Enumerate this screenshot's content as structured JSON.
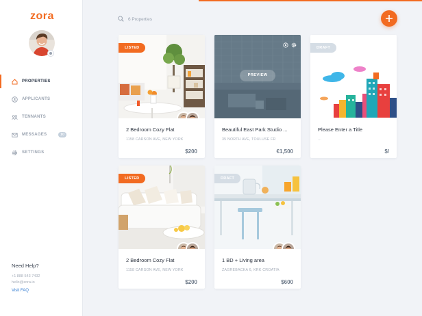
{
  "brand": {
    "name": "zora",
    "accent": "#f26b21"
  },
  "sidebar": {
    "items": [
      {
        "label": "PROPERTIES",
        "icon": "home-icon",
        "active": true
      },
      {
        "label": "APPLICANTS",
        "icon": "user-circle-icon",
        "active": false
      },
      {
        "label": "TENNANTS",
        "icon": "users-icon",
        "active": false
      },
      {
        "label": "MESSAGES",
        "icon": "envelope-icon",
        "active": false,
        "count": "10"
      },
      {
        "label": "SETTINGS",
        "icon": "gear-icon",
        "active": false
      }
    ],
    "help": {
      "title": "Need Help?",
      "phone": "+1 888 543 7432",
      "email": "hello@zora.io",
      "link": "Visit FAQ"
    }
  },
  "search": {
    "placeholder": "6 Properties"
  },
  "cards": [
    {
      "badge": "LISTED",
      "title": "2 Bedroom Cozy Flat",
      "address": "1158 CARSON AVE, NEW YORK",
      "price": "$200"
    },
    {
      "action": "PREVIEW",
      "title": "Beautiful East Park Studio ...",
      "address": "35 NORTH AVE, TOULUSE FR",
      "price": "€1,500"
    },
    {
      "badge": "DRAFT",
      "title": "Please Enter a Title",
      "address": "...",
      "price": "$/"
    },
    {
      "badge": "LISTED",
      "title": "2 Bedroom Cozy Flat",
      "address": "1158 CARSON AVE, NEW YORK",
      "price": "$200"
    },
    {
      "badge": "DRAFT",
      "title": "1 BD + Living area",
      "address": "ZAGREBACKA 6, KRK CROATIA",
      "price": "$600"
    }
  ]
}
